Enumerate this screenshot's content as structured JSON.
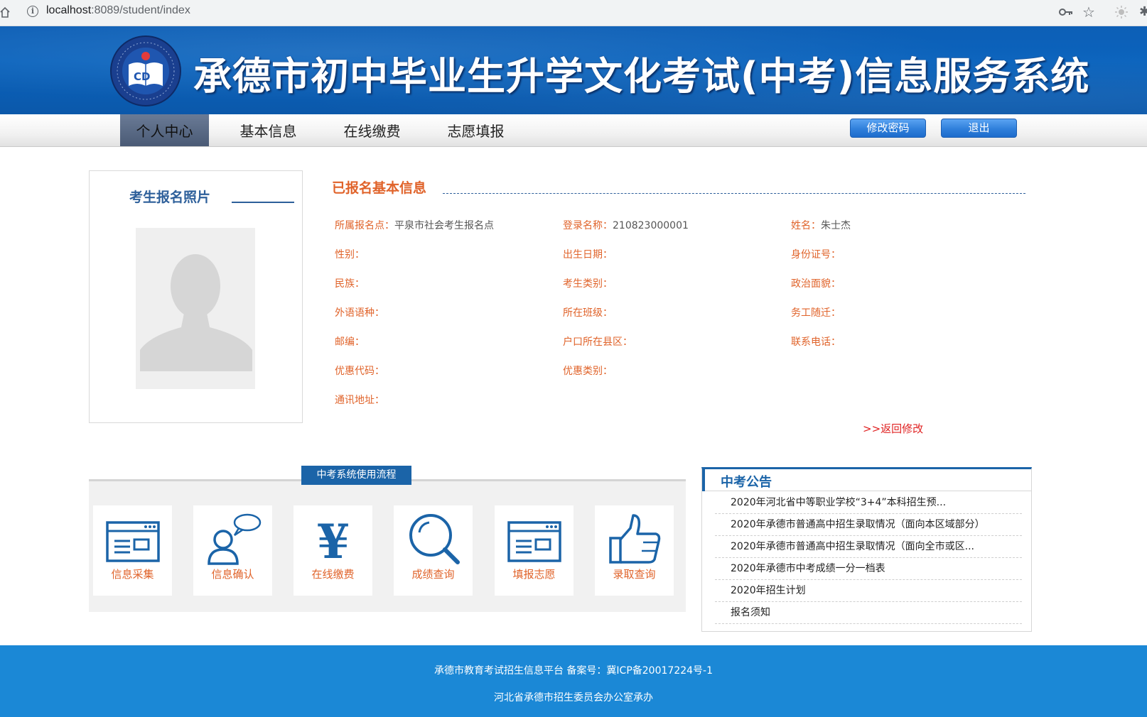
{
  "browser": {
    "url_host": "localhost",
    "url_path": ":8089/student/index"
  },
  "header": {
    "title": "承德市初中毕业生升学文化考试(中考)信息服务系统",
    "logo_letters": "CD"
  },
  "nav": {
    "items": [
      {
        "label": "个人中心",
        "active": true
      },
      {
        "label": "基本信息",
        "active": false
      },
      {
        "label": "在线缴费",
        "active": false
      },
      {
        "label": "志愿填报",
        "active": false
      }
    ],
    "change_password": "修改密码",
    "logout": "退出"
  },
  "photo": {
    "title": "考生报名照片"
  },
  "info": {
    "title": "已报名基本信息",
    "fields": [
      {
        "label": "所属报名点：",
        "value": "平泉市社会考生报名点"
      },
      {
        "label": "登录名称：",
        "value": "210823000001"
      },
      {
        "label": "姓名：",
        "value": "朱士杰"
      },
      {
        "label": "性别：",
        "value": ""
      },
      {
        "label": "出生日期：",
        "value": ""
      },
      {
        "label": "身份证号：",
        "value": ""
      },
      {
        "label": "民族：",
        "value": ""
      },
      {
        "label": "考生类别：",
        "value": ""
      },
      {
        "label": "政治面貌：",
        "value": ""
      },
      {
        "label": "外语语种：",
        "value": ""
      },
      {
        "label": "所在班级：",
        "value": ""
      },
      {
        "label": "务工随迁：",
        "value": ""
      },
      {
        "label": "邮编：",
        "value": ""
      },
      {
        "label": "户口所在县区：",
        "value": ""
      },
      {
        "label": "联系电话：",
        "value": ""
      },
      {
        "label": "优惠代码：",
        "value": ""
      },
      {
        "label": "优惠类别：",
        "value": ""
      },
      {
        "label": "通讯地址：",
        "value": ""
      }
    ],
    "back_link": ">>返回修改"
  },
  "process": {
    "title": "中考系统使用流程",
    "steps": [
      {
        "label": "信息采集",
        "icon": "browser-window-icon"
      },
      {
        "label": "信息确认",
        "icon": "user-chat-icon"
      },
      {
        "label": "在线缴费",
        "icon": "yen-icon"
      },
      {
        "label": "成绩查询",
        "icon": "magnifier-icon"
      },
      {
        "label": "填报志愿",
        "icon": "browser-window-icon"
      },
      {
        "label": "录取查询",
        "icon": "thumbs-up-icon"
      }
    ]
  },
  "notice": {
    "title": "中考公告",
    "items": [
      "2020年河北省中等职业学校“3+4”本科招生预...",
      "2020年承德市普通高中招生录取情况（面向本区域部分）",
      "2020年承德市普通高中招生录取情况（面向全市或区...",
      "2020年承德市中考成绩一分一档表",
      "2020年招生计划",
      "报名须知"
    ]
  },
  "footer": {
    "line1": "承德市教育考试招生信息平台 备案号：冀ICP备20017224号-1",
    "line2": "河北省承德市招生委员会办公室承办"
  },
  "colors": {
    "brand_blue": "#0b5fb5",
    "accent_orange": "#e0632a",
    "link_red": "#e02222",
    "footer_blue": "#1b88d6"
  }
}
